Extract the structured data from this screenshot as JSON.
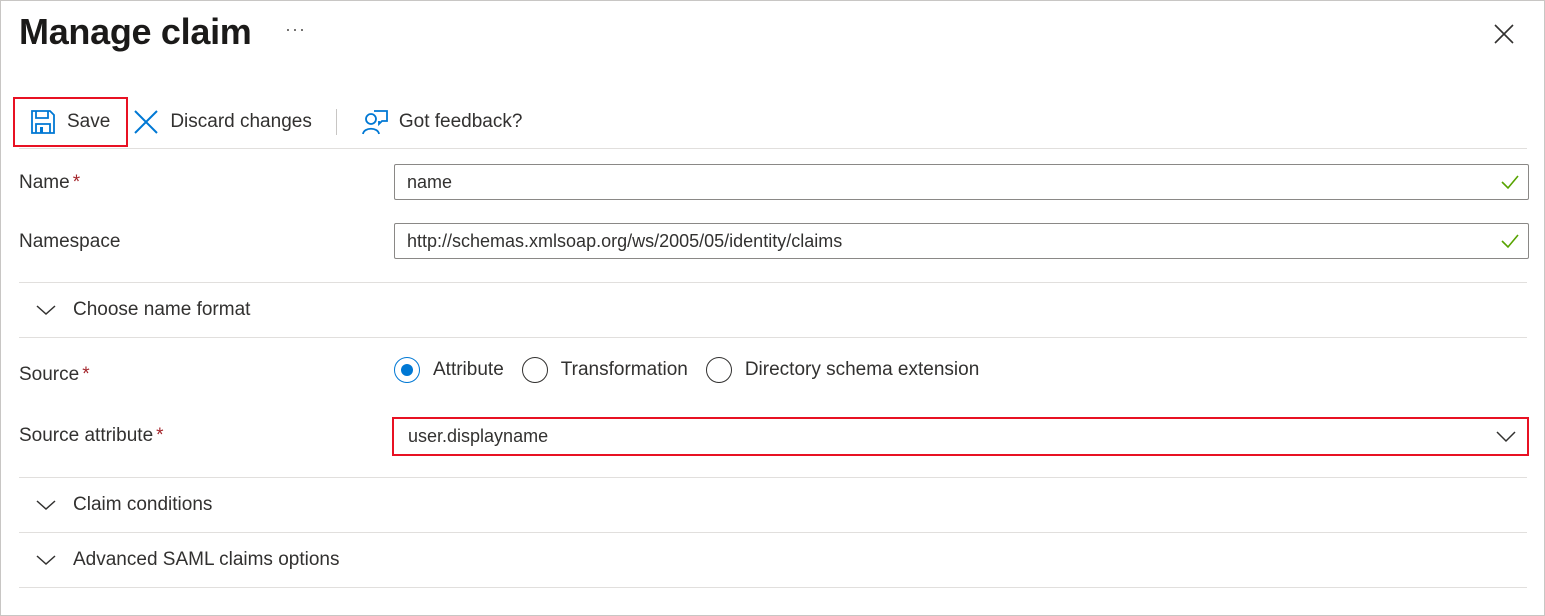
{
  "header": {
    "title": "Manage claim",
    "more_label": "···",
    "close_icon": "close-icon"
  },
  "toolbar": {
    "save_label": "Save",
    "discard_label": "Discard changes",
    "feedback_label": "Got feedback?",
    "icons": {
      "save": "save-icon",
      "discard": "discard-x-icon",
      "feedback": "feedback-person-icon"
    }
  },
  "form": {
    "name": {
      "label": "Name",
      "required": "*",
      "value": "name",
      "valid": true
    },
    "namespace": {
      "label": "Namespace",
      "value": "http://schemas.xmlsoap.org/ws/2005/05/identity/claims",
      "valid": true
    },
    "name_format_section": {
      "label": "Choose name format",
      "expanded": false
    },
    "source": {
      "label": "Source",
      "required": "*",
      "options": [
        {
          "label": "Attribute",
          "checked": true
        },
        {
          "label": "Transformation",
          "checked": false
        },
        {
          "label": "Directory schema extension",
          "checked": false
        }
      ]
    },
    "source_attribute": {
      "label": "Source attribute",
      "required": "*",
      "value": "user.displayname"
    },
    "claim_conditions_section": {
      "label": "Claim conditions",
      "expanded": false
    },
    "advanced_section": {
      "label": "Advanced SAML claims options",
      "expanded": false
    }
  },
  "colors": {
    "accent": "#0078d4",
    "highlight": "#e81123",
    "required": "#a4262c",
    "valid_check": "#57a300"
  }
}
